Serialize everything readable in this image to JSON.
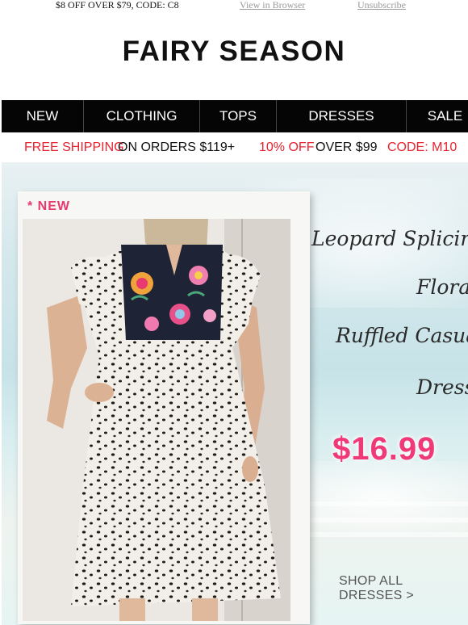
{
  "topbar": {
    "promo": "$8 OFF OVER $79, CODE: C8",
    "view_in_browser": "View in Browser",
    "unsubscribe": "Unsubscribe"
  },
  "brand": {
    "logo": "FAIRY SEASON"
  },
  "nav": {
    "items": [
      "NEW",
      "CLOTHING",
      "TOPS",
      "DRESSES",
      "SALE"
    ]
  },
  "shipping_bar": {
    "free_shipping": "FREE SHIPPING",
    "on_orders": "ON ORDERS $119+",
    "ten_off": "10% OFF",
    "over": "OVER $99",
    "code": "CODE: M10"
  },
  "hero": {
    "badge": "* NEW",
    "title_lines": [
      "Leopard Splicing",
      "Flora",
      "Ruffled Casua",
      "Dress"
    ],
    "price": "$16.99",
    "cta": "SHOP ALL DRESSES >",
    "colors": {
      "accent_pink": "#f03a78",
      "promo_red": "#e8232f",
      "nav_bg": "#050505"
    }
  }
}
